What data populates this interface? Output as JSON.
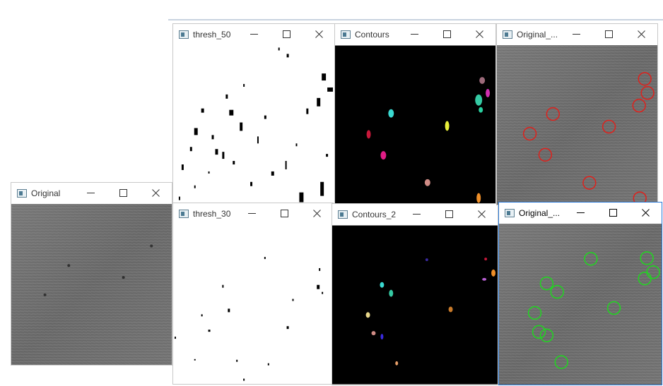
{
  "windows": {
    "original": {
      "title": "Original"
    },
    "thresh50": {
      "title": "thresh_50"
    },
    "thresh30": {
      "title": "thresh_30"
    },
    "contours": {
      "title": "Contours"
    },
    "contours2": {
      "title": "Contours_2"
    },
    "original_red": {
      "title": "Original_..."
    },
    "original_green": {
      "title": "Original_..."
    }
  },
  "colors": {
    "window_border": "#c8c8c8",
    "active_border": "#2b79d6",
    "terrain": "#6f6f6f",
    "red_marker": "#e0201b",
    "green_marker": "#1fd81f"
  }
}
